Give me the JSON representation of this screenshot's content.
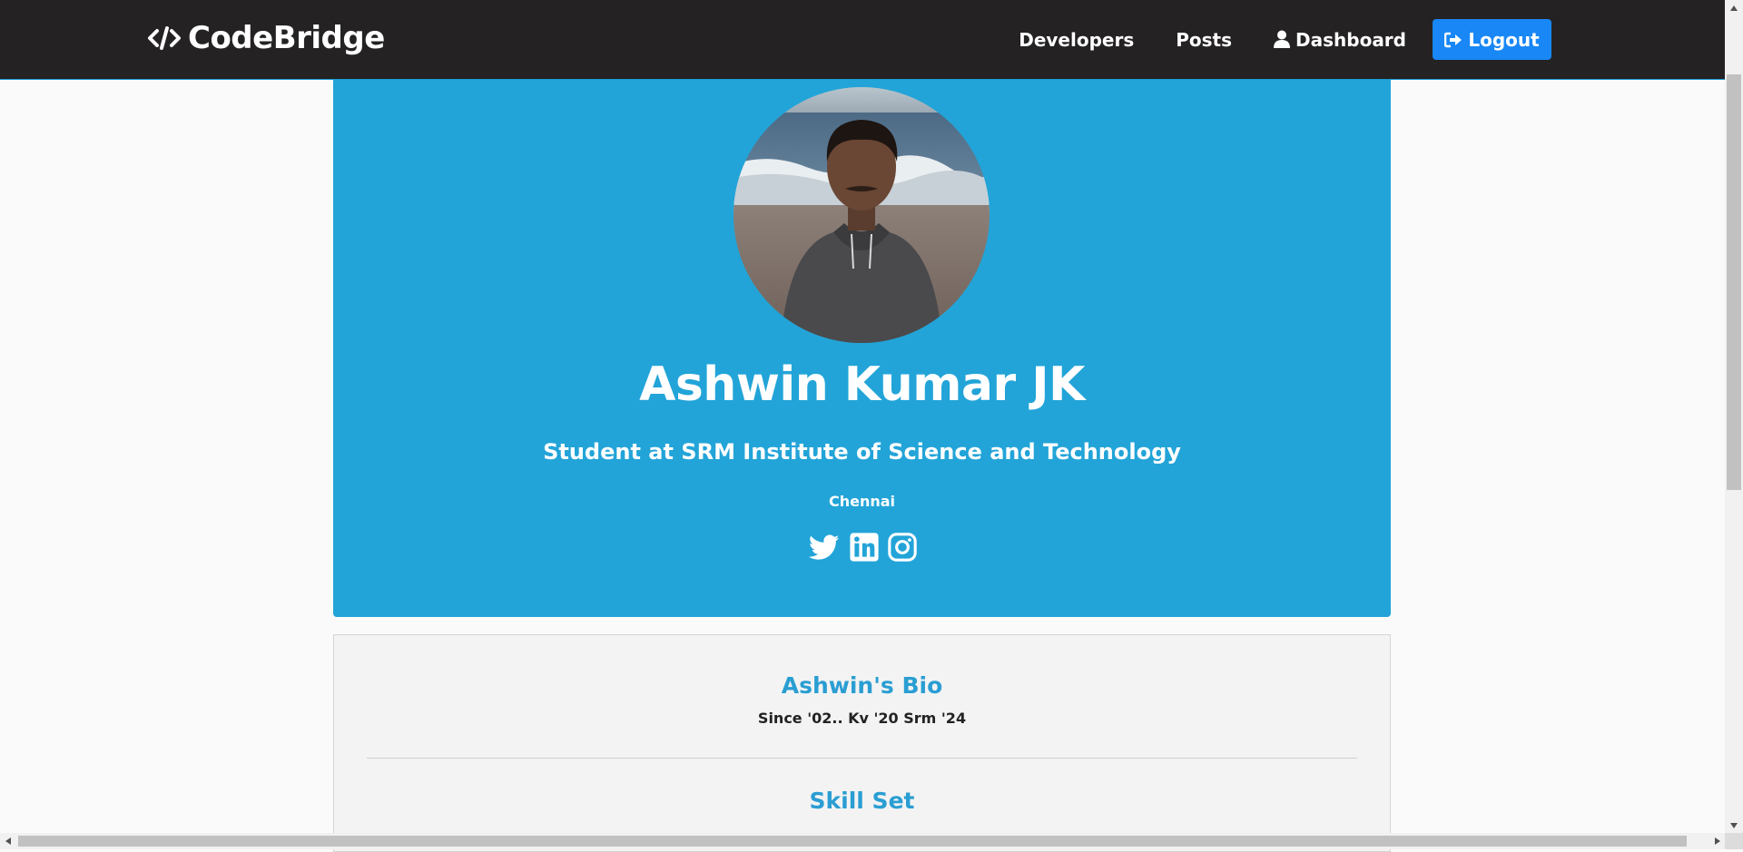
{
  "navbar": {
    "brand": "CodeBridge",
    "links": {
      "developers": "Developers",
      "posts": "Posts",
      "dashboard": "Dashboard"
    },
    "logout": "Logout",
    "colors": {
      "background": "#242222",
      "logout_button": "#1987f5"
    }
  },
  "profile": {
    "name": "Ashwin Kumar JK",
    "status": "Student at SRM Institute of Science and Technology",
    "location": "Chennai",
    "social": [
      "twitter-icon",
      "linkedin-icon",
      "instagram-icon"
    ],
    "colors": {
      "header_background": "#22a4d8"
    }
  },
  "about": {
    "bio_heading": "Ashwin's Bio",
    "bio": "Since '02.. Kv '20 Srm '24",
    "skills_heading": "Skill Set",
    "colors": {
      "heading": "#2a9ed3"
    }
  }
}
